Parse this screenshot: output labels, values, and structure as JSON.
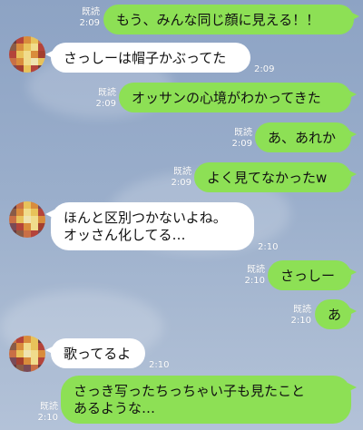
{
  "colors": {
    "sent_bubble": "#8de055",
    "received_bubble": "#ffffff",
    "meta_text": "#ffffff"
  },
  "messages": [
    {
      "side": "sent",
      "read": "既読",
      "time": "2:09",
      "lines": [
        "もう、みんな同じ顔に見える！！"
      ]
    },
    {
      "side": "received",
      "time": "2:09",
      "lines": [
        "さっしーは帽子かぶってた"
      ]
    },
    {
      "side": "sent",
      "read": "既読",
      "time": "2:09",
      "lines": [
        "オッサンの心境がわかってきた"
      ]
    },
    {
      "side": "sent",
      "read": "既読",
      "time": "2:09",
      "lines": [
        "あ、あれか"
      ]
    },
    {
      "side": "sent",
      "read": "既読",
      "time": "2:09",
      "lines": [
        "よく見てなかったw"
      ]
    },
    {
      "side": "received",
      "time": "2:10",
      "lines": [
        "ほんと区別つかないよね。",
        "オッさん化してる…"
      ]
    },
    {
      "side": "sent",
      "read": "既読",
      "time": "2:10",
      "lines": [
        "さっしー"
      ]
    },
    {
      "side": "sent",
      "read": "既読",
      "time": "2:10",
      "lines": [
        "あ"
      ]
    },
    {
      "side": "received",
      "time": "2:10",
      "lines": [
        "歌ってるよ"
      ]
    },
    {
      "side": "sent",
      "read": "既読",
      "time": "2:10",
      "lines": [
        "さっき写ったちっちゃい子も見たこと",
        "あるような…"
      ]
    }
  ]
}
